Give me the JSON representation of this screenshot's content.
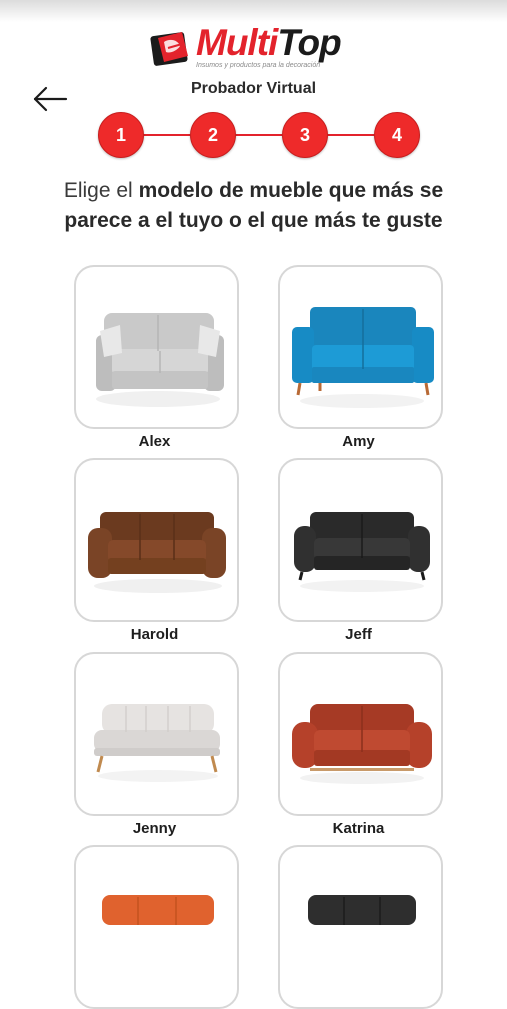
{
  "brand": {
    "name_part1": "Multi",
    "name_part2": "Top",
    "tagline": "Insumos y productos para la decoración"
  },
  "header": {
    "back_icon": "arrow-left-icon",
    "title": "Probador Virtual"
  },
  "steps": [
    "1",
    "2",
    "3",
    "4"
  ],
  "instruction": {
    "prefix": "Elige el ",
    "bold": "modelo de mueble que más se parece a el tuyo o el que más te guste"
  },
  "sofas": [
    {
      "name": "Alex",
      "color": "#cfcfcf"
    },
    {
      "name": "Amy",
      "color": "#1d96d0"
    },
    {
      "name": "Harold",
      "color": "#7a4426"
    },
    {
      "name": "Jeff",
      "color": "#2b2b2b"
    },
    {
      "name": "Jenny",
      "color": "#e6e3e1"
    },
    {
      "name": "Katrina",
      "color": "#b5412a"
    },
    {
      "name": "",
      "color": "#e0622e"
    },
    {
      "name": "",
      "color": "#2e2e2e"
    }
  ],
  "colors": {
    "accent": "#e3232c",
    "card_border": "#d7d7d7"
  }
}
